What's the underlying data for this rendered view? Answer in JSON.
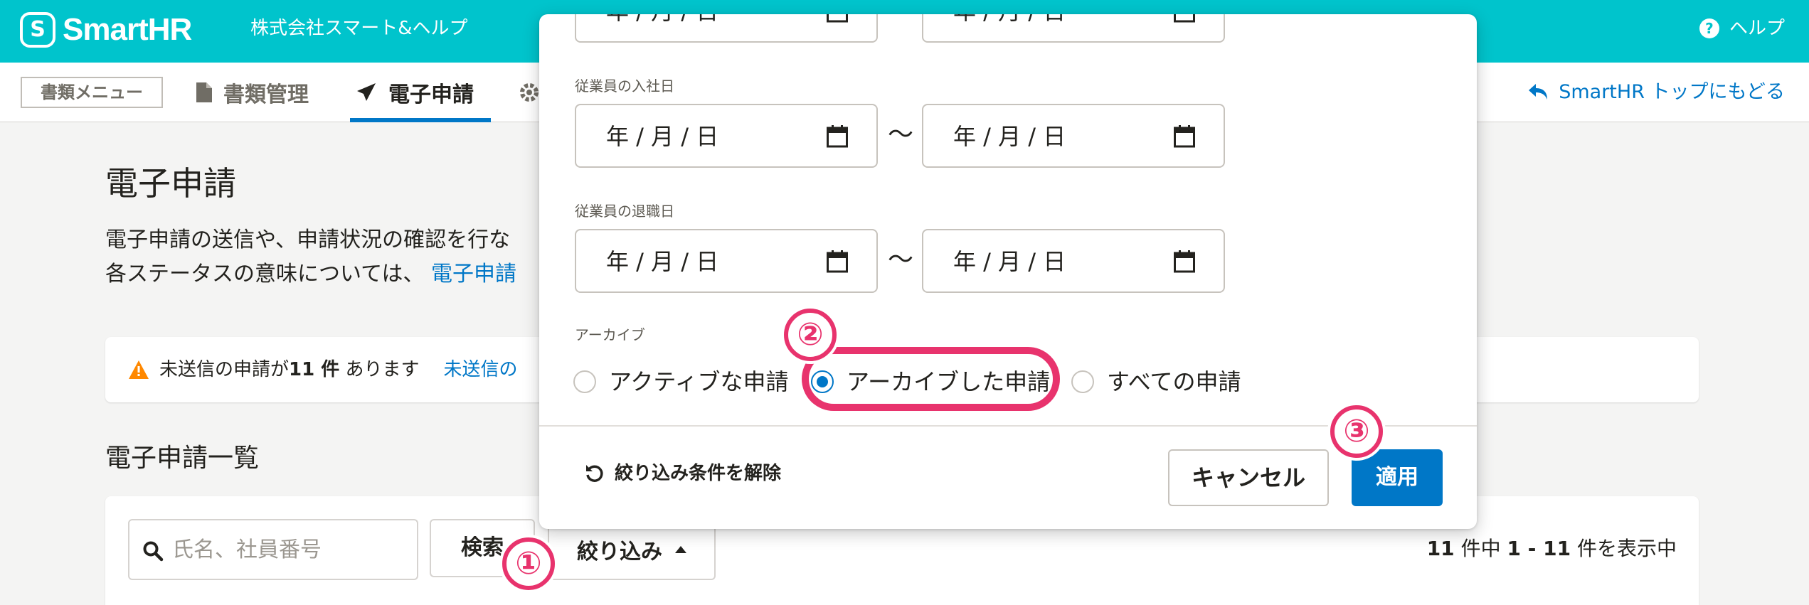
{
  "header": {
    "logo_mark": "S",
    "logo_text": "SmartHR",
    "company_name": "株式会社スマート&ヘルプ",
    "help_label": "ヘルプ"
  },
  "subnav": {
    "menu_label": "書類メニュー",
    "items": [
      {
        "label": "書類管理",
        "icon": "document-icon"
      },
      {
        "label": "電子申請",
        "icon": "send-icon",
        "active": true
      },
      {
        "label": "",
        "icon": "gear-icon"
      }
    ],
    "back_link": "SmartHR トップにもどる"
  },
  "main": {
    "title": "電子申請",
    "desc_line1": "電子申請の送信や、申請状況の確認を行な",
    "desc_line2_prefix": "各ステータスの意味については、",
    "desc_line2_link": "電子申請",
    "alert": {
      "icon": "warning-icon",
      "prefix": "未送信の申請が",
      "count": "11 件",
      "suffix": "あります",
      "link": "未送信の"
    },
    "list_title": "電子申請一覧",
    "search_placeholder": "氏名、社員番号",
    "search_button": "検索",
    "filter_button": "絞り込み",
    "count_total": "11",
    "count_mid": "件中",
    "count_range": "1 - 11",
    "count_suffix": "件を表示中"
  },
  "filter_panel": {
    "date_placeholder": "年 / 月 / 日",
    "range_separator": "〜",
    "hire_date_label": "従業員の入社日",
    "leave_date_label": "従業員の退職日",
    "archive_label": "アーカイブ",
    "archive_options": [
      {
        "label": "アクティブな申請",
        "selected": false
      },
      {
        "label": "アーカイブした申請",
        "selected": true
      },
      {
        "label": "すべての申請",
        "selected": false
      }
    ],
    "reset_label": "絞り込み条件を解除",
    "cancel_label": "キャンセル",
    "apply_label": "適用"
  },
  "annotations": {
    "step1": "①",
    "step2": "②",
    "step3": "③",
    "accent_color": "#e8336d"
  },
  "colors": {
    "header_bg": "#00c4cc",
    "primary": "#0077c7"
  }
}
